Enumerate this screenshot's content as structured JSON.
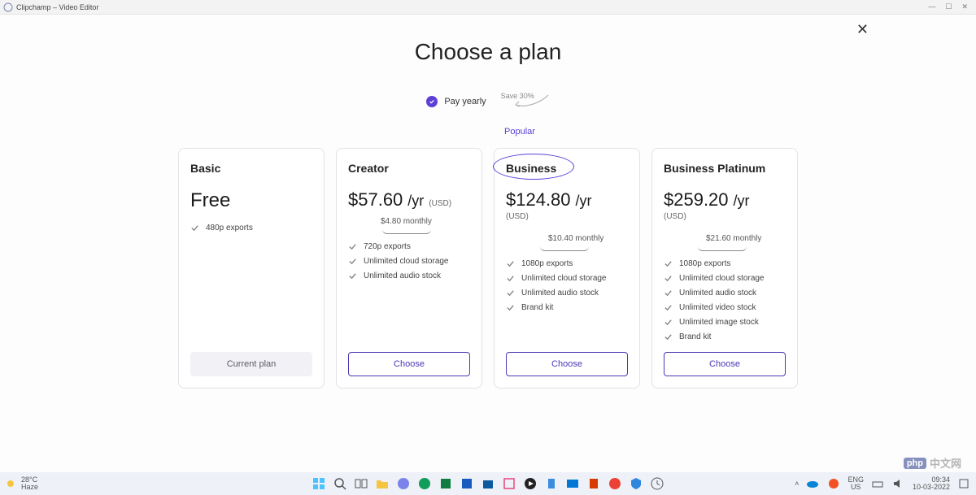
{
  "window": {
    "title": "Clipchamp – Video Editor",
    "min": "—",
    "max": "☐",
    "close": "✕"
  },
  "page": {
    "title": "Choose a plan",
    "pay_label": "Pay yearly",
    "save_text": "Save 30%",
    "popular": "Popular"
  },
  "plans": [
    {
      "name": "Basic",
      "price_label": "Free",
      "features": [
        "480p exports"
      ],
      "cta": "Current plan",
      "cta_type": "current"
    },
    {
      "name": "Creator",
      "price": "$57.60",
      "per": "/yr",
      "currency": "(USD)",
      "monthly": "$4.80 monthly",
      "features": [
        "720p exports",
        "Unlimited cloud storage",
        "Unlimited audio stock"
      ],
      "cta": "Choose",
      "cta_type": "choose"
    },
    {
      "name": "Business",
      "price": "$124.80",
      "per": "/yr",
      "currency": "(USD)",
      "monthly": "$10.40 monthly",
      "features": [
        "1080p exports",
        "Unlimited cloud storage",
        "Unlimited audio stock",
        "Brand kit"
      ],
      "cta": "Choose",
      "cta_type": "choose",
      "highlight": true
    },
    {
      "name": "Business Platinum",
      "price": "$259.20",
      "per": "/yr",
      "currency": "(USD)",
      "monthly": "$21.60 monthly",
      "features": [
        "1080p exports",
        "Unlimited cloud storage",
        "Unlimited audio stock",
        "Unlimited video stock",
        "Unlimited image stock",
        "Brand kit"
      ],
      "cta": "Choose",
      "cta_type": "choose"
    }
  ],
  "taskbar": {
    "temp": "28°C",
    "cond": "Haze",
    "lang1": "ENG",
    "lang2": "US",
    "time": "09:34",
    "date": "10-03-2022"
  },
  "watermark": {
    "brand": "php",
    "text": "中文网"
  }
}
